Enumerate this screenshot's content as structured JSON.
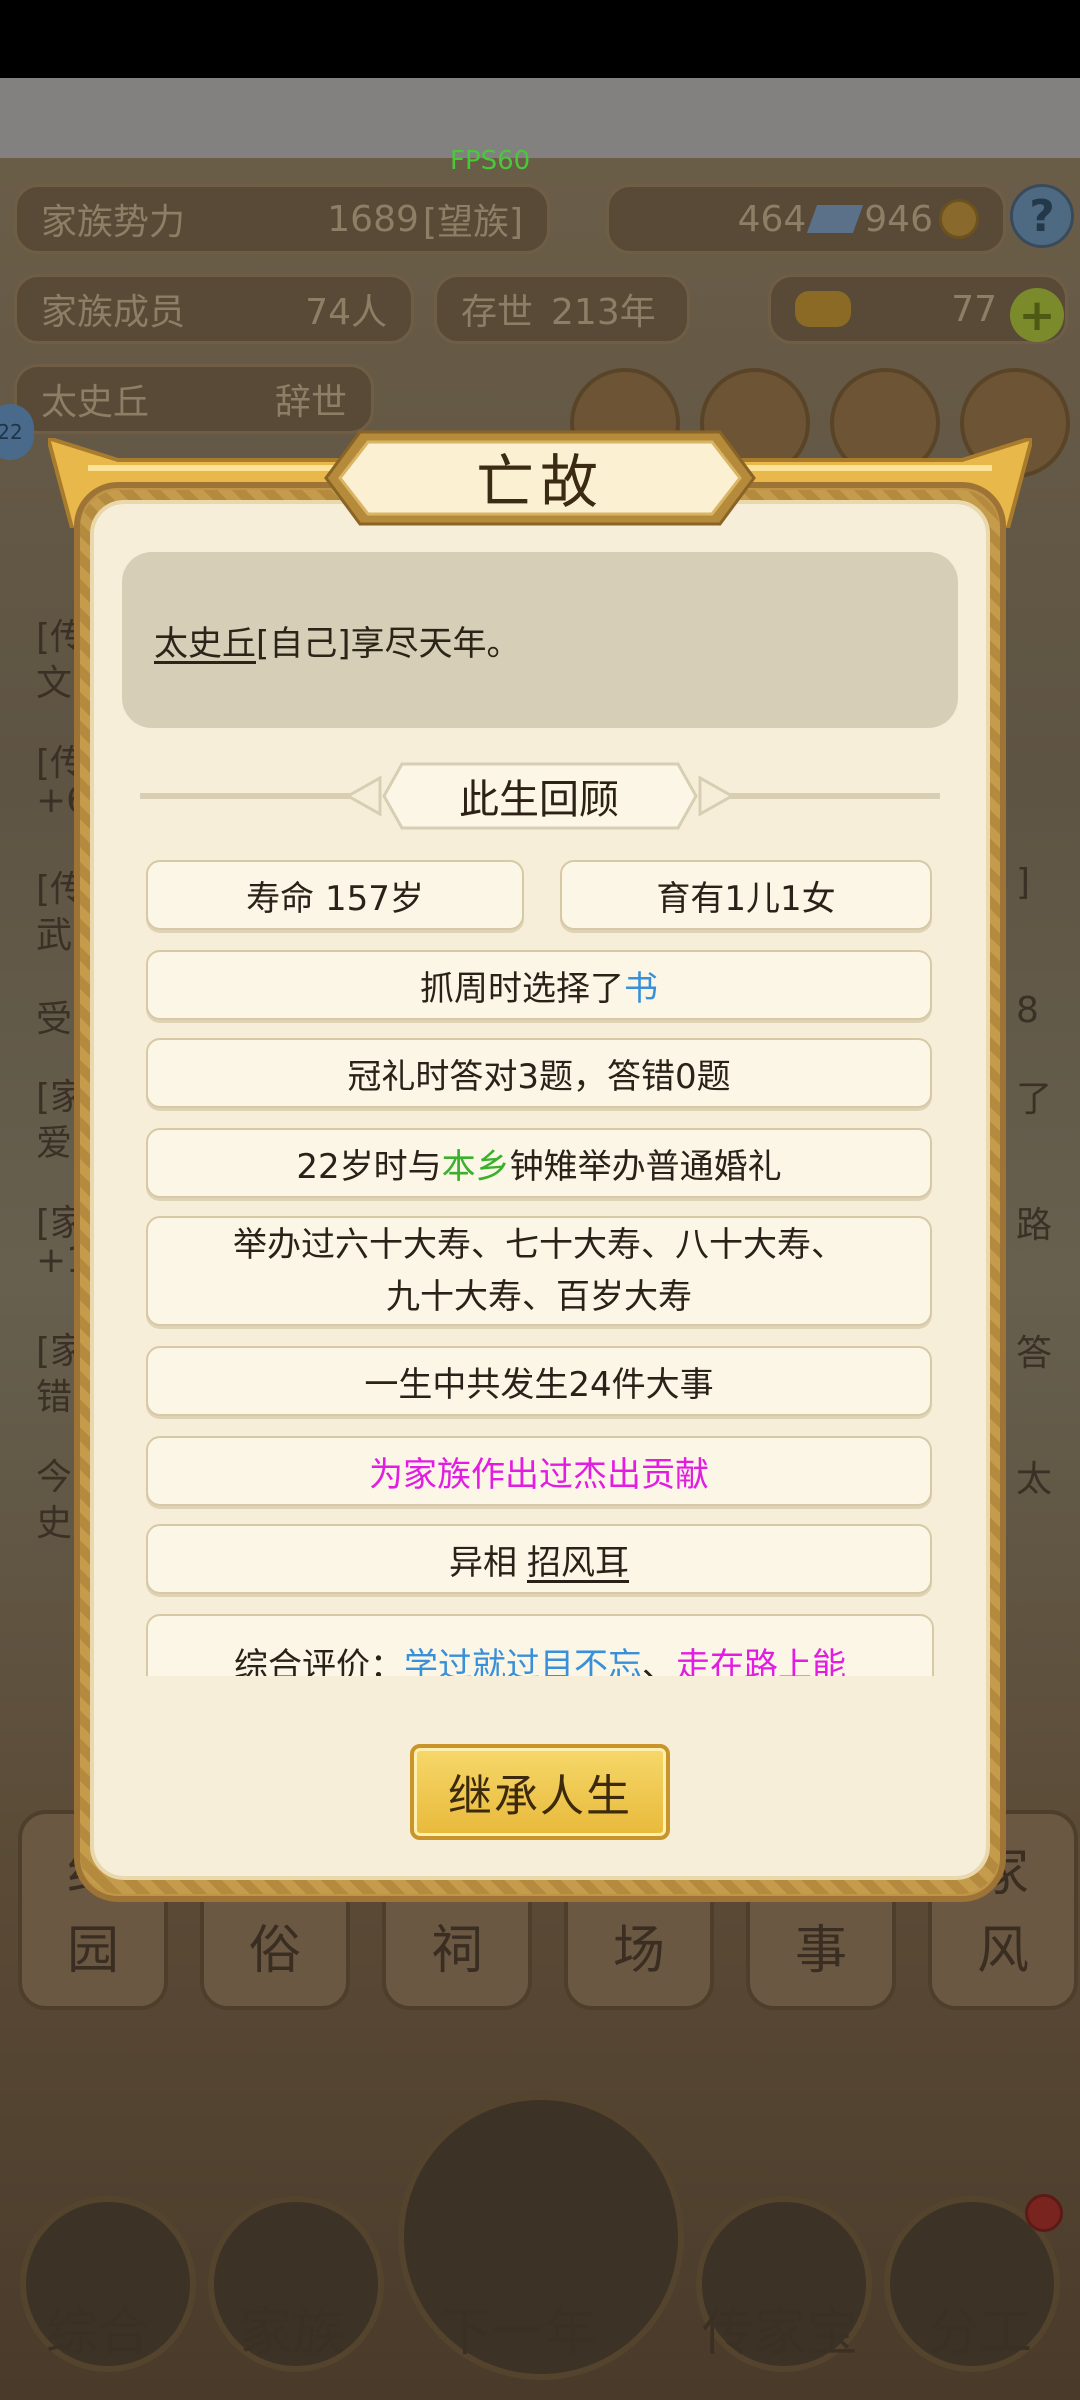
{
  "hud": {
    "fps": "FPS60",
    "family_power_label": "家族势力",
    "family_power_value": "1689",
    "family_power_rank": "[望族]",
    "currency_a": "464",
    "currency_b": "946",
    "members_label": "家族成员",
    "members_value": "74人",
    "existence_label": "存世",
    "existence_value": "213年",
    "gold": "77",
    "patriarch_name": "太史丘",
    "patriarch_status": "辞世",
    "help": "?",
    "plus": "+",
    "side_badge": "22"
  },
  "background": {
    "log_fragments": [
      "[传",
      "文",
      "[传",
      "+6",
      "[传",
      "武",
      "受",
      "[家",
      "爱",
      "[家",
      "+1",
      "[家",
      "错",
      "今",
      "史"
    ],
    "right_fragments": [
      "]",
      "8",
      "了",
      "路",
      "答",
      "太"
    ],
    "tiles": [
      {
        "line1": "约",
        "line2": "园"
      },
      {
        "line1": "民",
        "line2": "俗"
      },
      {
        "line1": "宗",
        "line2": "祠"
      },
      {
        "line1": "市",
        "line2": "场"
      },
      {
        "line1": "执",
        "line2": "事"
      },
      {
        "line1": "家",
        "line2": "风"
      }
    ],
    "nav": [
      "综合",
      "家族",
      "下一年",
      "传家宝",
      "分工"
    ]
  },
  "dialog": {
    "title": "亡故",
    "message_name": "太史丘",
    "message_rest": "[自己]享尽天年。",
    "section_title": "此生回顾",
    "lifespan": "寿命 157岁",
    "children": "育有1儿1女",
    "zhuazhou_prefix": "抓周时选择了",
    "zhuazhou_item": "书",
    "coming_of_age": "冠礼时答对3题，答错0题",
    "wedding_prefix": "22岁时与",
    "wedding_place": "本乡",
    "wedding_rest": "钟雉举办普通婚礼",
    "birthdays_line1": "举办过六十大寿、七十大寿、八十大寿、",
    "birthdays_line2": "九十大寿、百岁大寿",
    "events": "一生中共发生24件大事",
    "contribution": "为家族作出过杰出贡献",
    "trait_prefix": "异相 ",
    "trait_name": "招风耳",
    "evaluation_prefix": "综合评价：",
    "evaluation_a": "学过就过目不忘",
    "evaluation_sep": "、",
    "evaluation_b": "走在路上能",
    "inherit_button": "继承人生"
  },
  "colors": {
    "blue": "#3a90d8",
    "green": "#3ab02c",
    "magenta": "#e21ce2",
    "gold_button": "#f0c84c"
  }
}
